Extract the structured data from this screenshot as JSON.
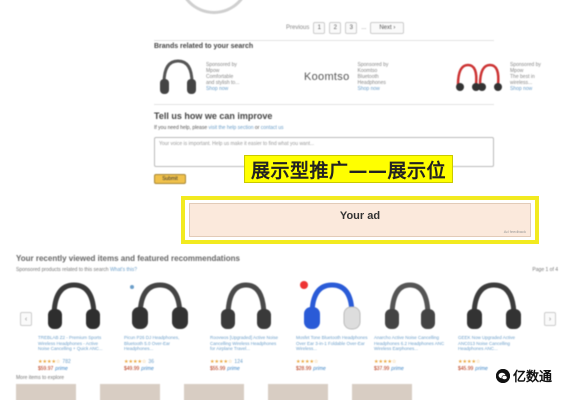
{
  "pagination": {
    "prev": "Previous",
    "pages": [
      "1",
      "2",
      "3"
    ],
    "ellipsis": "...",
    "next": "Next"
  },
  "brands": {
    "title": "Brands related to your search",
    "items": [
      {
        "name": "",
        "line1": "Sponsored by",
        "line2": "Mpow",
        "line3": "Comfortable",
        "line4": "and stylish to...",
        "link": "Shop now"
      },
      {
        "name": "Koomtso",
        "line1": "Sponsored by",
        "line2": "Koomtso",
        "line3": "Bluetooth",
        "line4": "Headphones",
        "link": "Shop now"
      },
      {
        "name": "",
        "line1": "Sponsored by",
        "line2": "Mpow",
        "line3": "The best in",
        "line4": "wireless...",
        "link": "Shop now"
      }
    ]
  },
  "improve": {
    "title": "Tell us how we can improve",
    "sub": "If you need help, please",
    "sub_link1": "visit the help section",
    "sub_or": "or",
    "sub_link2": "contact us",
    "placeholder": "Your voice is important. Help us make it easier to find what you want...",
    "submit": "Submit"
  },
  "overlay": {
    "label": "展示型推广——展示位"
  },
  "ad": {
    "text": "Your ad",
    "feedback": "Ad feedback"
  },
  "recent": {
    "title": "Your recently viewed items and featured recommendations",
    "sponsored": "Sponsored products related to this search",
    "whats_this": "What's this?",
    "page_of": "Page 1 of 4",
    "prev_arrow": "‹",
    "next_arrow": "›",
    "products": [
      {
        "title": "TREBLAB Z2 - Premium Sports Wireless Headphones - Active Noise Cancelling + Quick ANC...",
        "stars": "★★★★☆",
        "count": "782",
        "price": "$59.97",
        "prime": "prime"
      },
      {
        "title": "Picun P26 DJ Headphones, Bluetooth 5.0 Over-Ear Headphones...",
        "stars": "★★★★☆",
        "count": "36",
        "price": "$49.99",
        "prime": "prime"
      },
      {
        "title": "Roovwos [Upgraded] Active Noise Cancelling Wireless Headphones for Airplane Travel...",
        "stars": "★★★★☆",
        "count": "124",
        "price": "$55.99",
        "prime": "prime"
      },
      {
        "title": "Mosfet Tone Bluetooth Headphones Over Ear 3-in-1 Foldable Over-Ear Wireless...",
        "stars": "★★★★☆",
        "count": "",
        "price": "$28.99",
        "prime": "prime"
      },
      {
        "title": "Anarcho Active Noise Cancelling Headphones 6.2 Headphones ANC Wireless Earphones...",
        "stars": "★★★★☆",
        "count": "",
        "price": "$37.99",
        "prime": "prime"
      },
      {
        "title": "GEEK Now Upgraded Active ANC013 Noise Cancelling Headphones ANC...",
        "stars": "★★★★☆",
        "count": "",
        "price": "$45.99",
        "prime": "prime"
      }
    ]
  },
  "more": {
    "title": "More items to explore"
  },
  "watermark": {
    "text": "亿数通"
  }
}
